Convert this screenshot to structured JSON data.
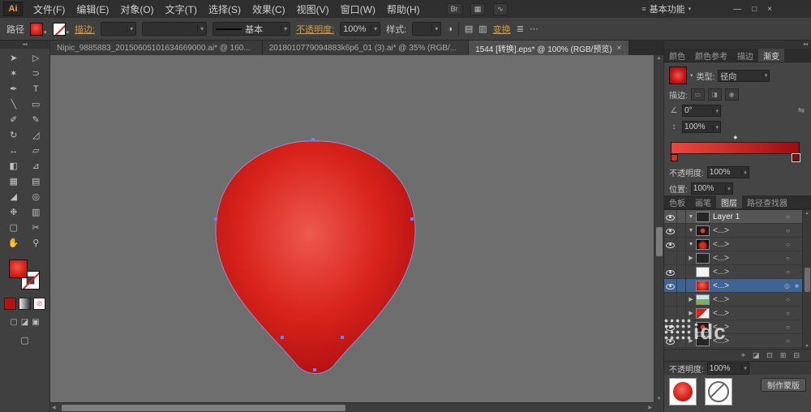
{
  "icons": {
    "dropdown_arrow": "▾",
    "collapse_arrows": "◂◂",
    "panel_menu": "≡",
    "scroll_up": "▲",
    "scroll_down": "▼",
    "scroll_left": "◀",
    "scroll_right": "▶",
    "angle": "∠",
    "aspect": "↕",
    "reverse": "⇋",
    "midpoint": "◆"
  },
  "menubar": {
    "logo": "Ai",
    "menus": [
      {
        "name": "menu-file",
        "label": "文件(F)"
      },
      {
        "name": "menu-edit",
        "label": "编辑(E)"
      },
      {
        "name": "menu-object",
        "label": "对象(O)"
      },
      {
        "name": "menu-type",
        "label": "文字(T)"
      },
      {
        "name": "menu-select",
        "label": "选择(S)"
      },
      {
        "name": "menu-effect",
        "label": "效果(C)"
      },
      {
        "name": "menu-view",
        "label": "视图(V)"
      },
      {
        "name": "menu-window",
        "label": "窗口(W)"
      },
      {
        "name": "menu-help",
        "label": "帮助(H)"
      }
    ],
    "app_icons": [
      {
        "name": "bridge-icon",
        "glyph": "Br"
      },
      {
        "name": "arrange-documents-icon",
        "glyph": "▦"
      },
      {
        "name": "cs-live-icon",
        "glyph": "∿"
      }
    ],
    "workspace_label": "基本功能",
    "win_min": "—",
    "win_restore": "□",
    "win_close": "×"
  },
  "controlbar": {
    "context": "路径",
    "stroke_link": "描边:",
    "stroke_style": "基本",
    "opacity_link": "不透明度:",
    "opacity_value": "100%",
    "style_label": "样式:",
    "transform_link": "变换",
    "recolor_glyph": "◑",
    "doc_glyph_a": "▤",
    "doc_glyph_b": "▥",
    "align_glyph": "≣",
    "more_glyph": "⋯"
  },
  "doc_tabs": [
    {
      "name": "doc-tab-1",
      "label": "Nipic_9885883_20150605101634669000.ai* @ 160...",
      "state": "",
      "close": ""
    },
    {
      "name": "doc-tab-2",
      "label": "2018010779094883k6p6_01 (3).ai* @ 35% (RGB/...",
      "state": "",
      "close": ""
    },
    {
      "name": "doc-tab-3",
      "label": "1544 [转换].eps* @ 100% (RGB/预览)",
      "state": "active",
      "close": "×"
    }
  ],
  "tools": [
    {
      "name": "selection-tool",
      "glyph": "➤"
    },
    {
      "name": "direct-selection-tool",
      "glyph": "▷"
    },
    {
      "name": "magic-wand-tool",
      "glyph": "✶"
    },
    {
      "name": "lasso-tool",
      "glyph": "⊃"
    },
    {
      "name": "pen-tool",
      "glyph": "✒"
    },
    {
      "name": "type-tool",
      "glyph": "T"
    },
    {
      "name": "line-segment-tool",
      "glyph": "╲"
    },
    {
      "name": "rectangle-tool",
      "glyph": "▭"
    },
    {
      "name": "paintbrush-tool",
      "glyph": "✐"
    },
    {
      "name": "pencil-tool",
      "glyph": "✎"
    },
    {
      "name": "rotate-tool",
      "glyph": "↻"
    },
    {
      "name": "scale-tool",
      "glyph": "◿"
    },
    {
      "name": "width-tool",
      "glyph": "↔"
    },
    {
      "name": "free-transform-tool",
      "glyph": "▱"
    },
    {
      "name": "shape-builder-tool",
      "glyph": "◧"
    },
    {
      "name": "perspective-grid-tool",
      "glyph": "⊿"
    },
    {
      "name": "mesh-tool",
      "glyph": "▦"
    },
    {
      "name": "gradient-tool",
      "glyph": "▤"
    },
    {
      "name": "eyedropper-tool",
      "glyph": "◢"
    },
    {
      "name": "blend-tool",
      "glyph": "◎"
    },
    {
      "name": "symbol-sprayer-tool",
      "glyph": "❉"
    },
    {
      "name": "column-graph-tool",
      "glyph": "▥"
    },
    {
      "name": "artboard-tool",
      "glyph": "▢"
    },
    {
      "name": "slice-tool",
      "glyph": "✂"
    },
    {
      "name": "hand-tool",
      "glyph": "✋"
    },
    {
      "name": "zoom-tool",
      "glyph": "⚲"
    }
  ],
  "toolbar_bottom": {
    "mini_swatches": [
      {
        "name": "color-mode-icon",
        "glyph": "",
        "cls": "ms-color"
      },
      {
        "name": "gradient-mode-icon",
        "glyph": "",
        "cls": "ms-grad"
      },
      {
        "name": "none-mode-icon",
        "glyph": "⊘",
        "cls": "ms-none"
      }
    ],
    "draw_modes": [
      {
        "name": "draw-normal-icon",
        "glyph": "▢"
      },
      {
        "name": "draw-behind-icon",
        "glyph": "◪"
      },
      {
        "name": "draw-inside-icon",
        "glyph": "▣"
      }
    ],
    "screen_mode_glyph": "▢"
  },
  "canvas": {
    "zoom": "100%",
    "shape_gradient": {
      "center": "#ee594e",
      "mid": "#d8231b",
      "edge": "#ad0e10"
    },
    "outline": "#8a97e3",
    "anchor_color": "#6f83e8"
  },
  "panels": {
    "top_tabs": [
      {
        "name": "tab-color",
        "label": "颜色",
        "state": ""
      },
      {
        "name": "tab-color-guide",
        "label": "颜色参考",
        "state": ""
      },
      {
        "name": "tab-stroke",
        "label": "描边",
        "state": ""
      },
      {
        "name": "tab-gradient",
        "label": "渐变",
        "state": "active"
      }
    ],
    "gradient": {
      "type_label": "类型:",
      "type_value": "径向",
      "stroke_label": "描边:",
      "angle_value": "0°",
      "aspect_value": "100%",
      "opacity_label": "不透明度:",
      "opacity_value": "100%",
      "location_label": "位置:",
      "location_value": "100%",
      "bar_start": "#ea4a3d",
      "bar_end": "#9e0c10"
    },
    "mid_tabs": [
      {
        "name": "tab-swatches",
        "label": "色板",
        "state": ""
      },
      {
        "name": "tab-brushes",
        "label": "画笔",
        "state": ""
      },
      {
        "name": "tab-layers",
        "label": "图层",
        "state": "active"
      },
      {
        "name": "tab-pathfinder",
        "label": "路径查找器",
        "state": ""
      }
    ],
    "layers": {
      "rows": [
        {
          "label": "Layer 1",
          "eye": "on",
          "expand": "▼",
          "thumb": "t-dark",
          "row": "row-open",
          "target": "○",
          "sel": ""
        },
        {
          "label": "<...>",
          "eye": "on",
          "expand": "▼",
          "thumb": "t-reddot",
          "row": "",
          "target": "○",
          "sel": ""
        },
        {
          "label": "<...>",
          "eye": "on",
          "expand": "▼",
          "thumb": "t-glow",
          "row": "",
          "target": "○",
          "sel": ""
        },
        {
          "label": "<...>",
          "eye": "off",
          "expand": "▶",
          "thumb": "t-dark",
          "row": "",
          "target": "○",
          "sel": ""
        },
        {
          "label": "<...>",
          "eye": "on",
          "expand": "",
          "thumb": "t-white",
          "row": "",
          "target": "○",
          "sel": ""
        },
        {
          "label": "<...>",
          "eye": "on",
          "expand": "",
          "thumb": "t-ball",
          "row": "row-sel",
          "target": "◎",
          "sel": "■"
        },
        {
          "label": "<...>",
          "eye": "off",
          "expand": "▶",
          "thumb": "t-photo",
          "row": "",
          "target": "○",
          "sel": ""
        },
        {
          "label": "<...>",
          "eye": "off",
          "expand": "▶",
          "thumb": "t-split",
          "row": "",
          "target": "○",
          "sel": ""
        },
        {
          "label": "<...>",
          "eye": "on",
          "expand": "",
          "thumb": "t-reddot",
          "row": "",
          "target": "○",
          "sel": ""
        },
        {
          "label": "<...>",
          "eye": "on",
          "expand": "▶",
          "thumb": "t-dark",
          "row": "",
          "target": "○",
          "sel": ""
        }
      ],
      "footer_icons": [
        {
          "name": "locate-object-icon",
          "glyph": "⌖"
        },
        {
          "name": "make-clip-mask-icon",
          "glyph": "◪"
        },
        {
          "name": "new-sublayer-icon",
          "glyph": "⊡"
        },
        {
          "name": "new-layer-icon",
          "glyph": "⊞"
        },
        {
          "name": "delete-layer-icon",
          "glyph": "⊟"
        }
      ]
    },
    "transparency": {
      "opacity_label": "不透明度:",
      "opacity_value": "100%",
      "make_mask_label": "制作蒙版"
    }
  },
  "watermark": {
    "text": "idc"
  }
}
